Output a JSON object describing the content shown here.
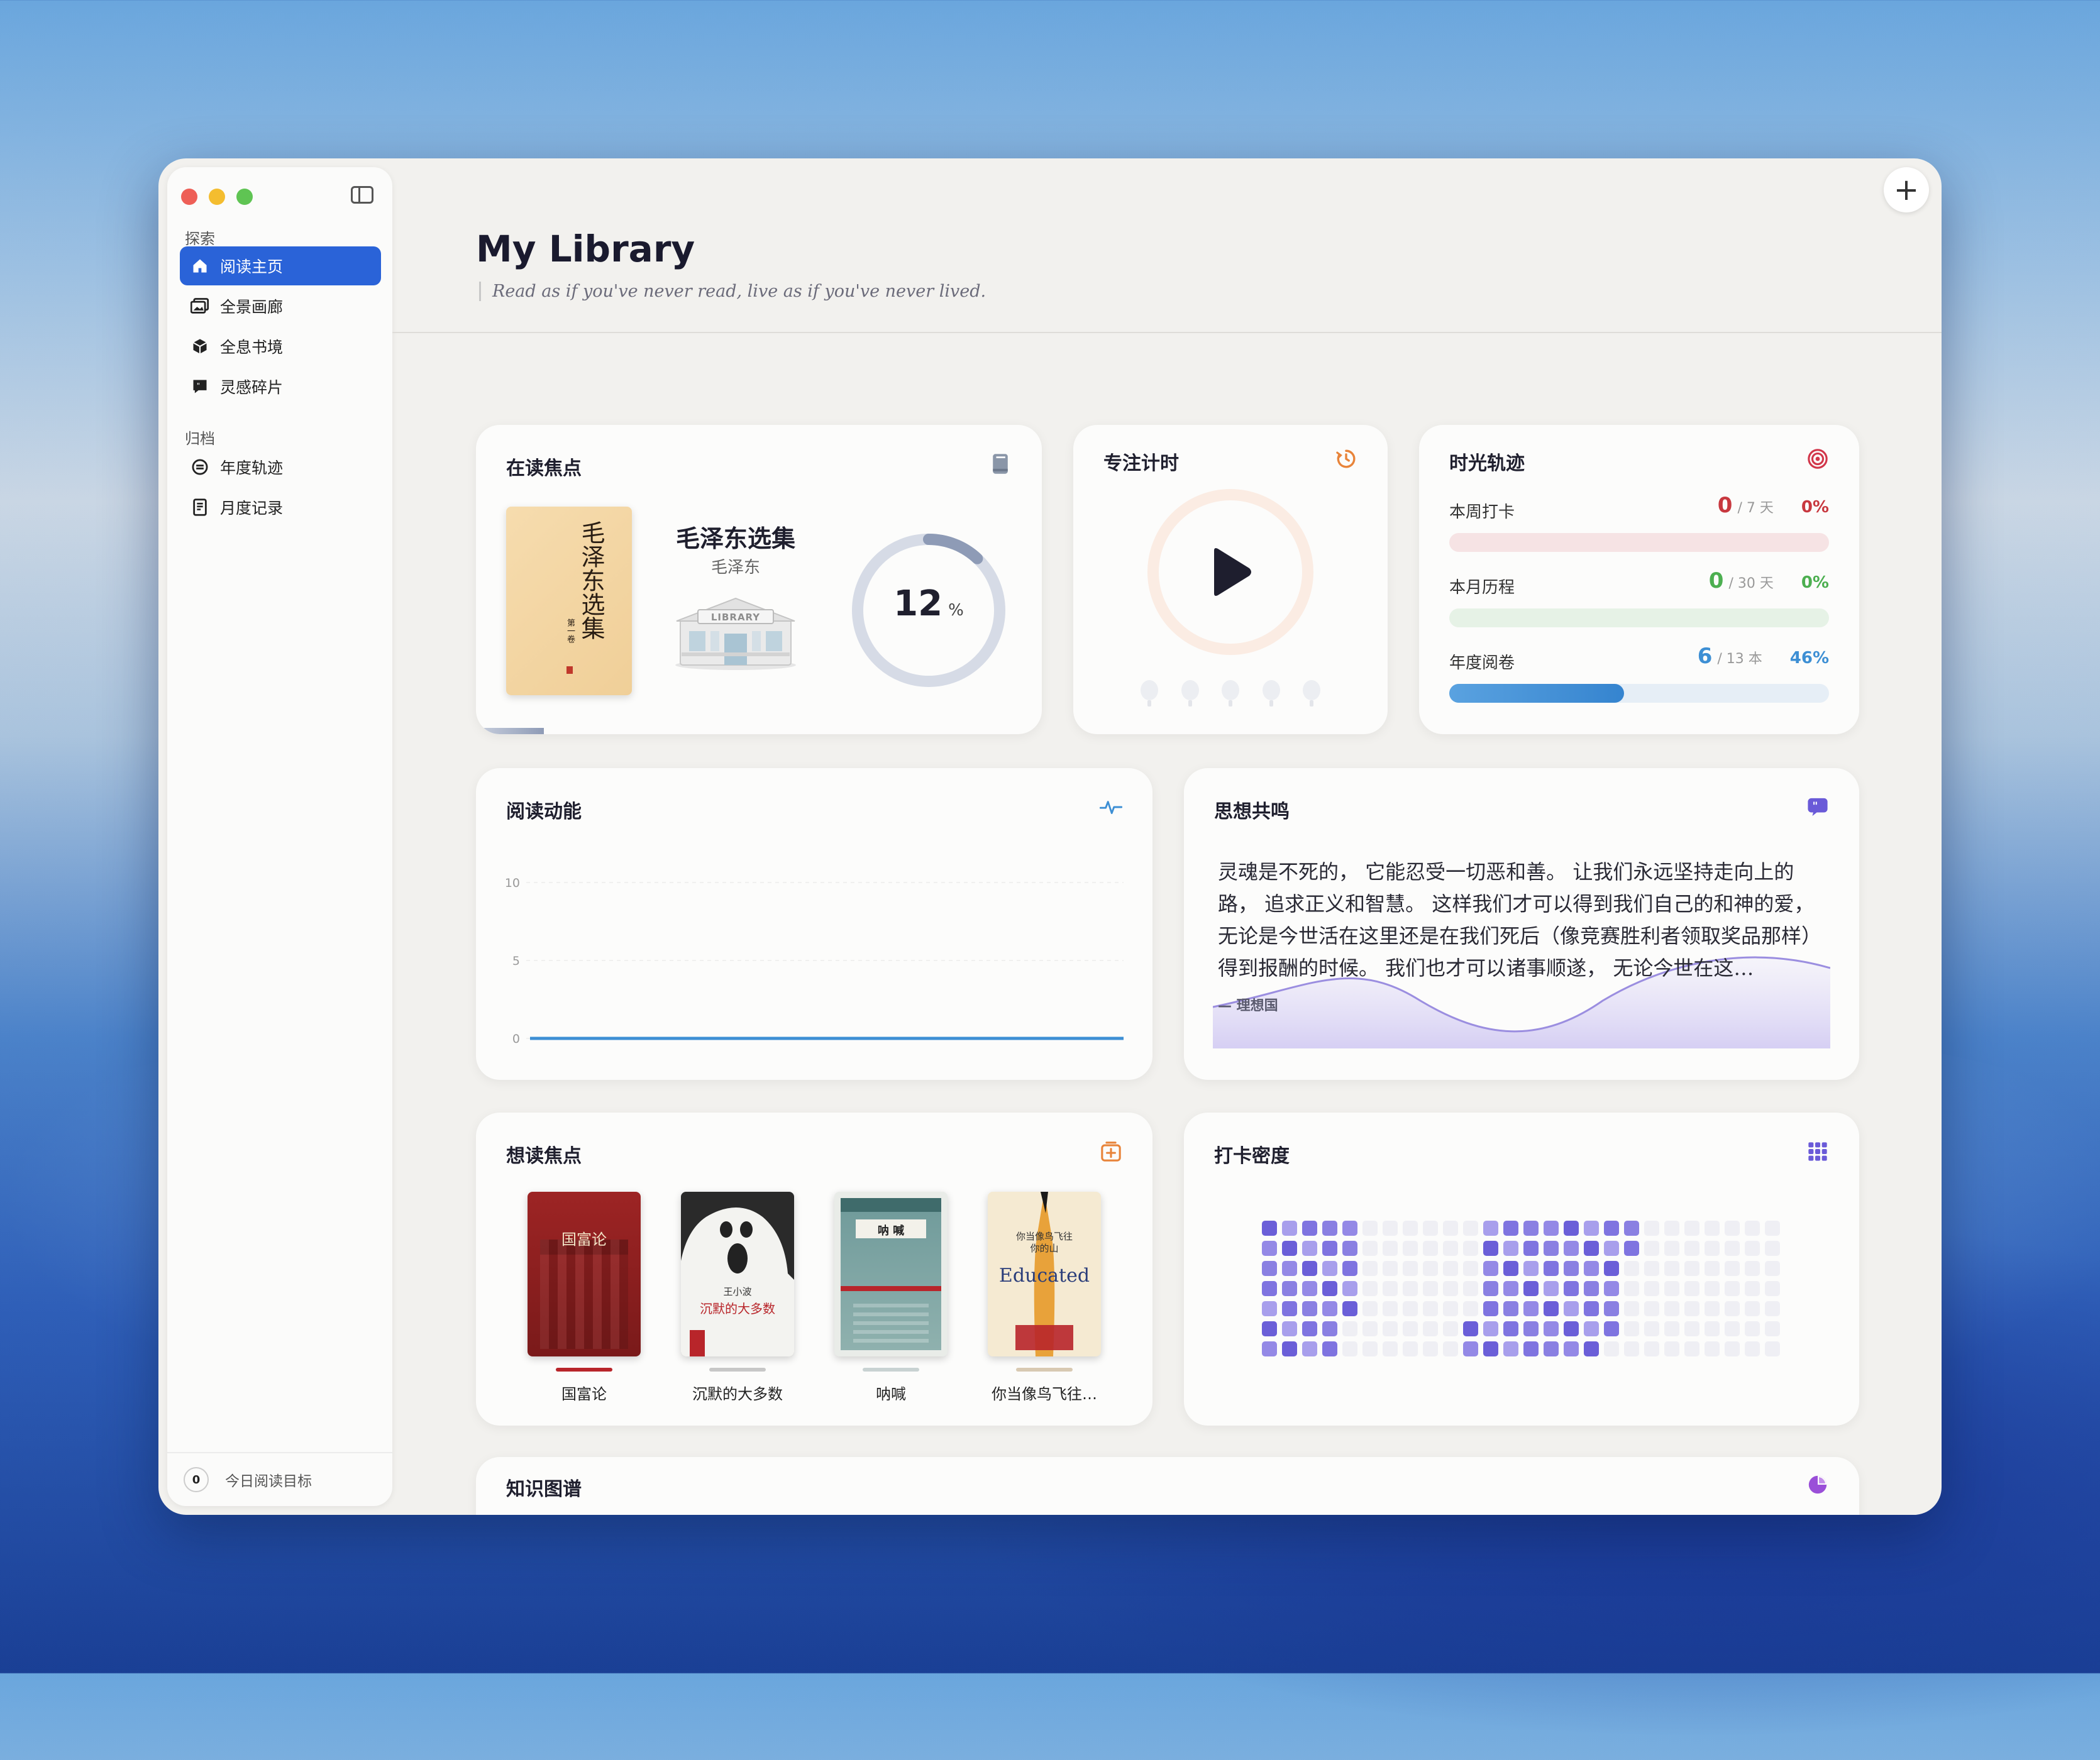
{
  "window": {
    "title": "My Library",
    "subtitle": "Read as if you've never read, live as if you've never lived."
  },
  "sidebar": {
    "section_explore": "探索",
    "section_archive": "归档",
    "items": [
      {
        "label": "阅读主页",
        "icon": "house-icon",
        "active": true
      },
      {
        "label": "全景画廊",
        "icon": "gallery-icon"
      },
      {
        "label": "全息书境",
        "icon": "cube-icon"
      },
      {
        "label": "灵感碎片",
        "icon": "quote-bubble-icon"
      },
      {
        "label": "年度轨迹",
        "icon": "disc-icon"
      },
      {
        "label": "月度记录",
        "icon": "document-icon"
      }
    ],
    "footer": {
      "badge": "0",
      "label": "今日阅读目标"
    }
  },
  "current": {
    "title": "在读焦点",
    "book_title": "毛泽东选集",
    "author": "毛泽东",
    "cover_text": "毛泽东选集",
    "cover_sub": "第一卷",
    "progress_value": "12",
    "progress_unit": "%",
    "progress_fraction": 0.12,
    "library_sign": "LIBRARY"
  },
  "focus": {
    "title": "专注计时"
  },
  "time": {
    "title": "时光轨迹",
    "rows": [
      {
        "label": "本周打卡",
        "value": "0",
        "unit": "/ 7 天",
        "pct": "0%",
        "fraction": 0,
        "color": "#c8383f",
        "track": "#f6e3e4"
      },
      {
        "label": "本月历程",
        "value": "0",
        "unit": "/ 30 天",
        "pct": "0%",
        "fraction": 0,
        "color": "#4caf50",
        "track": "#e6f2e6"
      },
      {
        "label": "年度阅卷",
        "value": "6",
        "unit": "/ 13 本",
        "pct": "46%",
        "fraction": 0.46,
        "color": "#3d8fd4",
        "track": "#e6eef6"
      }
    ]
  },
  "activity": {
    "title": "阅读动能",
    "chart_data": {
      "type": "line",
      "title": "",
      "y_ticks": [
        "10",
        "5",
        "0"
      ],
      "ylim": [
        0,
        10
      ],
      "values": [
        0,
        0,
        0,
        0,
        0,
        0,
        0
      ],
      "grid": true
    }
  },
  "resonance": {
    "title": "思想共鸣",
    "quote": "灵魂是不死的， 它能忍受一切恶和善。 让我们永远坚持走向上的路， 追求正义和智慧。 这样我们才可以得到我们自己的和神的爱， 无论是今世活在这里还是在我们死后（像竞赛胜利者领取奖品那样）得到报酬的时候。 我们也才可以诸事顺遂， 无论今世在这…",
    "source": "— 理想国"
  },
  "wishlist": {
    "title": "想读焦点",
    "books": [
      {
        "name": "国富论",
        "cover_title": "国富论",
        "bg": "#8e1e1e",
        "line": "#b8252a"
      },
      {
        "name": "沉默的大多数",
        "cover_title": "沉默的大多数",
        "cover_author": "王小波",
        "bg": "#2a2a2a",
        "line": "#c7c7c7"
      },
      {
        "name": "呐喊",
        "cover_title": "呐 喊",
        "bg": "#6f9a9a",
        "line": "#c8d2d2"
      },
      {
        "name": "你当像鸟飞往…",
        "cover_title": "你当像鸟飞往你的山",
        "cover_en": "Educated",
        "bg": "#f2e6cf",
        "line": "#d8c9b2"
      }
    ]
  },
  "heatmap": {
    "title": "打卡密度"
  },
  "graph": {
    "title": "知识图谱"
  }
}
